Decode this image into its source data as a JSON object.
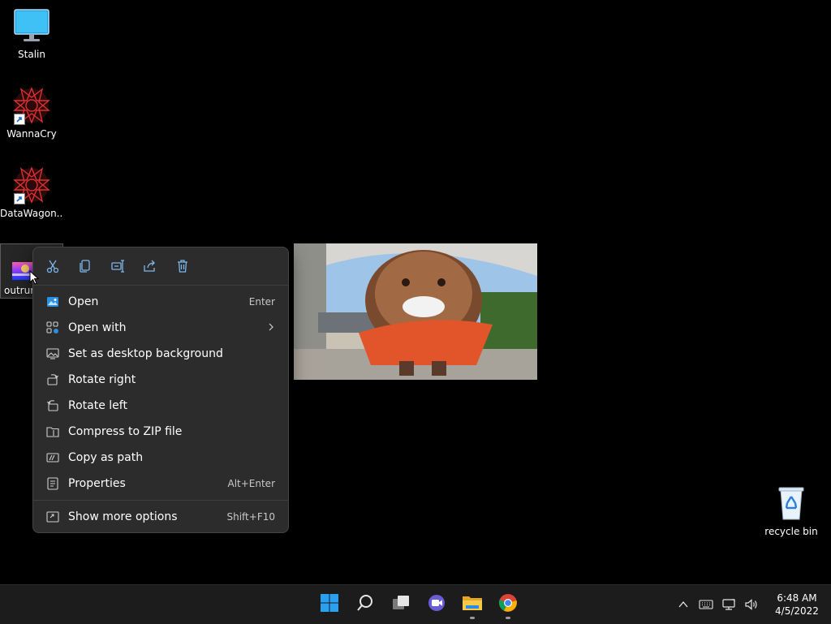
{
  "desktop": {
    "icons": [
      {
        "label": "Stalin"
      },
      {
        "label": "WannaCry"
      },
      {
        "label": "DataWagon..."
      },
      {
        "label": "outrun"
      },
      {
        "label": "recycle bin"
      }
    ]
  },
  "context_menu": {
    "toolbar": [
      "cut-icon",
      "copy-icon",
      "rename-icon",
      "share-icon",
      "delete-icon"
    ],
    "items": [
      {
        "label": "Open",
        "shortcut": "Enter"
      },
      {
        "label": "Open with",
        "shortcut": ""
      },
      {
        "label": "Set as desktop background",
        "shortcut": ""
      },
      {
        "label": "Rotate right",
        "shortcut": ""
      },
      {
        "label": "Rotate left",
        "shortcut": ""
      },
      {
        "label": "Compress to ZIP file",
        "shortcut": ""
      },
      {
        "label": "Copy as path",
        "shortcut": ""
      },
      {
        "label": "Properties",
        "shortcut": "Alt+Enter"
      },
      {
        "label": "Show more options",
        "shortcut": "Shift+F10"
      }
    ]
  },
  "taskbar": {
    "apps": [
      "start-icon",
      "search-icon",
      "task-view-icon",
      "chat-icon",
      "file-explorer-icon",
      "chrome-icon"
    ],
    "tray": [
      "chevron-up-icon",
      "keyboard-icon",
      "network-icon",
      "volume-icon"
    ],
    "clock": {
      "time": "6:48 AM",
      "date": "4/5/2022"
    }
  },
  "colors": {
    "menu_bg": "#2c2c2c",
    "taskbar_bg": "#1c1c1c",
    "accent": "#0a84ff"
  }
}
